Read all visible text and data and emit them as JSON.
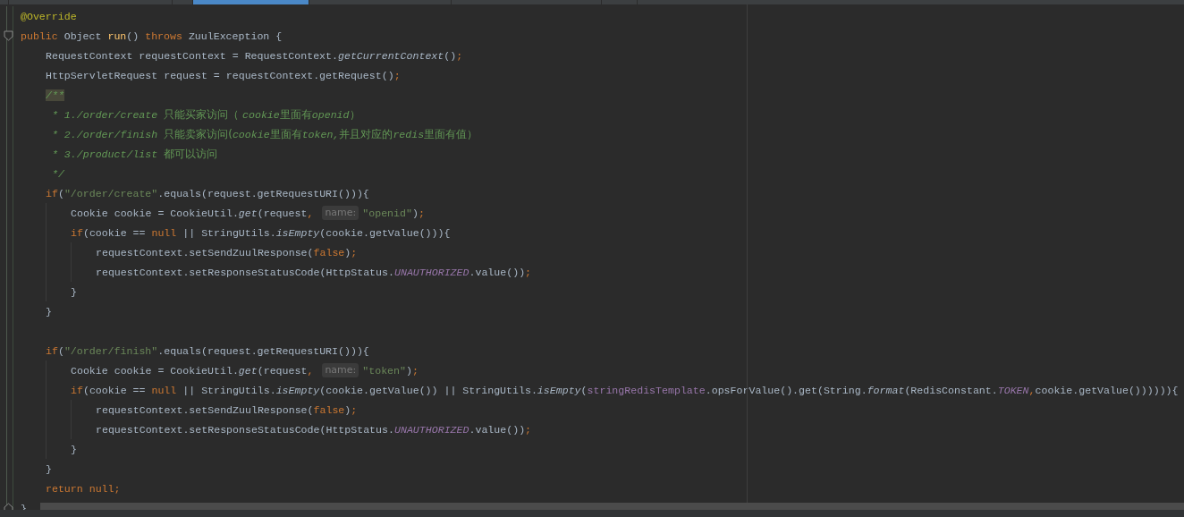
{
  "tabs": [
    {
      "selected": false
    },
    {
      "selected": false
    },
    {
      "selected": false
    },
    {
      "selected": true
    },
    {
      "selected": false
    },
    {
      "selected": false
    },
    {
      "selected": false
    }
  ],
  "lines": [
    {
      "kind": "code",
      "segments": [
        {
          "kind": "code",
          "tokens": [
            {
              "kind": "annot",
              "text": "@Override"
            }
          ]
        }
      ]
    },
    {
      "kind": "code",
      "segments": [
        {
          "kind": "code",
          "tokens": [
            {
              "kind": "kw",
              "text": "public"
            },
            {
              "kind": "plain",
              "text": " Object "
            },
            {
              "kind": "decl",
              "text": "run"
            },
            {
              "kind": "plain",
              "text": "() "
            },
            {
              "kind": "kw",
              "text": "throws"
            },
            {
              "kind": "plain",
              "text": " ZuulException {"
            }
          ]
        }
      ],
      "children": [
        {
          "kind": "code",
          "segments": [
            {
              "kind": "code",
              "tokens": [
                {
                  "kind": "plain",
                  "text": "RequestContext requestContext = RequestContext."
                },
                {
                  "kind": "static",
                  "text": "getCurrentContext"
                },
                {
                  "kind": "plain",
                  "text": "()"
                },
                {
                  "kind": "semi",
                  "text": ";"
                }
              ]
            }
          ]
        },
        {
          "kind": "code",
          "segments": [
            {
              "kind": "code",
              "tokens": [
                {
                  "kind": "plain",
                  "text": "HttpServletRequest request = requestContext.getRequest()"
                },
                {
                  "kind": "semi",
                  "text": ";"
                }
              ]
            }
          ]
        },
        {
          "kind": "code",
          "segments": [
            {
              "kind": "code",
              "tokens": [
                {
                  "kind": "dochl",
                  "text": "/**"
                }
              ]
            }
          ]
        },
        {
          "kind": "code",
          "segments": [
            {
              "kind": "code",
              "tokens": [
                {
                  "kind": "doc",
                  "text": " * 1./order/create "
                },
                {
                  "kind": "doccjk",
                  "text": "只能买家访问（ "
                },
                {
                  "kind": "doc",
                  "text": "cookie"
                },
                {
                  "kind": "doccjk",
                  "text": "里面有"
                },
                {
                  "kind": "doc",
                  "text": "openid"
                },
                {
                  "kind": "doccjk",
                  "text": "）"
                }
              ]
            }
          ]
        },
        {
          "kind": "code",
          "segments": [
            {
              "kind": "code",
              "tokens": [
                {
                  "kind": "doc",
                  "text": " * 2./order/finish "
                },
                {
                  "kind": "doccjk",
                  "text": "只能卖家访问("
                },
                {
                  "kind": "doc",
                  "text": "cookie"
                },
                {
                  "kind": "doccjk",
                  "text": "里面有"
                },
                {
                  "kind": "doc",
                  "text": "token,"
                },
                {
                  "kind": "doccjk",
                  "text": "并且对应的"
                },
                {
                  "kind": "doc",
                  "text": "redis"
                },
                {
                  "kind": "doccjk",
                  "text": "里面有值）"
                }
              ]
            }
          ]
        },
        {
          "kind": "code",
          "segments": [
            {
              "kind": "code",
              "tokens": [
                {
                  "kind": "doc",
                  "text": " * 3./product/list "
                },
                {
                  "kind": "doccjk",
                  "text": "都可以访问"
                }
              ]
            }
          ]
        },
        {
          "kind": "code",
          "segments": [
            {
              "kind": "code",
              "tokens": [
                {
                  "kind": "doc",
                  "text": " */"
                }
              ]
            }
          ]
        },
        {
          "kind": "code",
          "segments": [
            {
              "kind": "code",
              "tokens": [
                {
                  "kind": "kw",
                  "text": "if"
                },
                {
                  "kind": "plain",
                  "text": "("
                },
                {
                  "kind": "str",
                  "text": "\"/order/create\""
                },
                {
                  "kind": "plain",
                  "text": ".equals(request.getRequestURI())){"
                }
              ]
            }
          ],
          "children": [
            {
              "kind": "code",
              "segments": [
                {
                  "kind": "code",
                  "tokens": [
                    {
                      "kind": "plain",
                      "text": "Cookie cookie = CookieUtil."
                    },
                    {
                      "kind": "static",
                      "text": "get"
                    },
                    {
                      "kind": "plain",
                      "text": "(request"
                    },
                    {
                      "kind": "semi",
                      "text": ","
                    }
                  ]
                },
                {
                  "kind": "hint",
                  "text": "name:"
                },
                {
                  "kind": "code",
                  "tokens": [
                    {
                      "kind": "str",
                      "text": "\"openid\""
                    },
                    {
                      "kind": "plain",
                      "text": ")"
                    },
                    {
                      "kind": "semi",
                      "text": ";"
                    }
                  ]
                }
              ]
            },
            {
              "kind": "code",
              "segments": [
                {
                  "kind": "code",
                  "tokens": [
                    {
                      "kind": "kw",
                      "text": "if"
                    },
                    {
                      "kind": "plain",
                      "text": "(cookie == "
                    },
                    {
                      "kind": "kw",
                      "text": "null"
                    },
                    {
                      "kind": "plain",
                      "text": " || StringUtils."
                    },
                    {
                      "kind": "static",
                      "text": "isEmpty"
                    },
                    {
                      "kind": "plain",
                      "text": "(cookie.getValue())){"
                    }
                  ]
                }
              ],
              "children": [
                {
                  "kind": "code",
                  "segments": [
                    {
                      "kind": "code",
                      "tokens": [
                        {
                          "kind": "plain",
                          "text": "requestContext.setSendZuulResponse("
                        },
                        {
                          "kind": "kw",
                          "text": "false"
                        },
                        {
                          "kind": "plain",
                          "text": ")"
                        },
                        {
                          "kind": "semi",
                          "text": ";"
                        }
                      ]
                    }
                  ]
                },
                {
                  "kind": "code",
                  "segments": [
                    {
                      "kind": "code",
                      "tokens": [
                        {
                          "kind": "plain",
                          "text": "requestContext.setResponseStatusCode(HttpStatus."
                        },
                        {
                          "kind": "const",
                          "text": "UNAUTHORIZED"
                        },
                        {
                          "kind": "plain",
                          "text": ".value())"
                        },
                        {
                          "kind": "semi",
                          "text": ";"
                        }
                      ]
                    }
                  ]
                }
              ]
            },
            {
              "kind": "code",
              "segments": [
                {
                  "kind": "code",
                  "tokens": [
                    {
                      "kind": "plain",
                      "text": "}"
                    }
                  ]
                }
              ]
            }
          ]
        },
        {
          "kind": "code",
          "segments": [
            {
              "kind": "code",
              "tokens": [
                {
                  "kind": "plain",
                  "text": "}"
                }
              ]
            }
          ]
        },
        {
          "kind": "blank"
        },
        {
          "kind": "code",
          "segments": [
            {
              "kind": "code",
              "tokens": [
                {
                  "kind": "kw",
                  "text": "if"
                },
                {
                  "kind": "plain",
                  "text": "("
                },
                {
                  "kind": "str",
                  "text": "\"/order/finish\""
                },
                {
                  "kind": "plain",
                  "text": ".equals(request.getRequestURI())){"
                }
              ]
            }
          ],
          "children": [
            {
              "kind": "code",
              "segments": [
                {
                  "kind": "code",
                  "tokens": [
                    {
                      "kind": "plain",
                      "text": "Cookie cookie = CookieUtil."
                    },
                    {
                      "kind": "static",
                      "text": "get"
                    },
                    {
                      "kind": "plain",
                      "text": "(request"
                    },
                    {
                      "kind": "semi",
                      "text": ","
                    }
                  ]
                },
                {
                  "kind": "hint",
                  "text": "name:"
                },
                {
                  "kind": "code",
                  "tokens": [
                    {
                      "kind": "str",
                      "text": "\"token\""
                    },
                    {
                      "kind": "plain",
                      "text": ")"
                    },
                    {
                      "kind": "semi",
                      "text": ";"
                    }
                  ]
                }
              ]
            },
            {
              "kind": "code",
              "segments": [
                {
                  "kind": "code",
                  "tokens": [
                    {
                      "kind": "kw",
                      "text": "if"
                    },
                    {
                      "kind": "plain",
                      "text": "(cookie == "
                    },
                    {
                      "kind": "kw",
                      "text": "null"
                    },
                    {
                      "kind": "plain",
                      "text": " || StringUtils."
                    },
                    {
                      "kind": "static",
                      "text": "isEmpty"
                    },
                    {
                      "kind": "plain",
                      "text": "(cookie.getValue()) || StringUtils."
                    },
                    {
                      "kind": "static",
                      "text": "isEmpty"
                    },
                    {
                      "kind": "plain",
                      "text": "("
                    },
                    {
                      "kind": "field",
                      "text": "stringRedisTemplate"
                    },
                    {
                      "kind": "plain",
                      "text": ".opsForValue().get(String."
                    },
                    {
                      "kind": "static",
                      "text": "format"
                    },
                    {
                      "kind": "plain",
                      "text": "(RedisConstant."
                    },
                    {
                      "kind": "const",
                      "text": "TOKEN"
                    },
                    {
                      "kind": "semi",
                      "text": ","
                    },
                    {
                      "kind": "plain",
                      "text": "cookie.getValue()))))){"
                    }
                  ]
                }
              ],
              "children": [
                {
                  "kind": "code",
                  "segments": [
                    {
                      "kind": "code",
                      "tokens": [
                        {
                          "kind": "plain",
                          "text": "requestContext.setSendZuulResponse("
                        },
                        {
                          "kind": "kw",
                          "text": "false"
                        },
                        {
                          "kind": "plain",
                          "text": ")"
                        },
                        {
                          "kind": "semi",
                          "text": ";"
                        }
                      ]
                    }
                  ]
                },
                {
                  "kind": "code",
                  "segments": [
                    {
                      "kind": "code",
                      "tokens": [
                        {
                          "kind": "plain",
                          "text": "requestContext.setResponseStatusCode(HttpStatus."
                        },
                        {
                          "kind": "const",
                          "text": "UNAUTHORIZED"
                        },
                        {
                          "kind": "plain",
                          "text": ".value())"
                        },
                        {
                          "kind": "semi",
                          "text": ";"
                        }
                      ]
                    }
                  ]
                }
              ]
            },
            {
              "kind": "code",
              "segments": [
                {
                  "kind": "code",
                  "tokens": [
                    {
                      "kind": "plain",
                      "text": "}"
                    }
                  ]
                }
              ]
            }
          ]
        },
        {
          "kind": "code",
          "segments": [
            {
              "kind": "code",
              "tokens": [
                {
                  "kind": "plain",
                  "text": "}"
                }
              ]
            }
          ]
        },
        {
          "kind": "code",
          "segments": [
            {
              "kind": "code",
              "tokens": [
                {
                  "kind": "kw",
                  "text": "return "
                },
                {
                  "kind": "kw",
                  "text": "null"
                },
                {
                  "kind": "semi",
                  "text": ";"
                }
              ]
            }
          ]
        }
      ]
    },
    {
      "kind": "code",
      "segments": [
        {
          "kind": "code",
          "tokens": [
            {
              "kind": "plain",
              "text": "}"
            }
          ]
        }
      ]
    }
  ]
}
